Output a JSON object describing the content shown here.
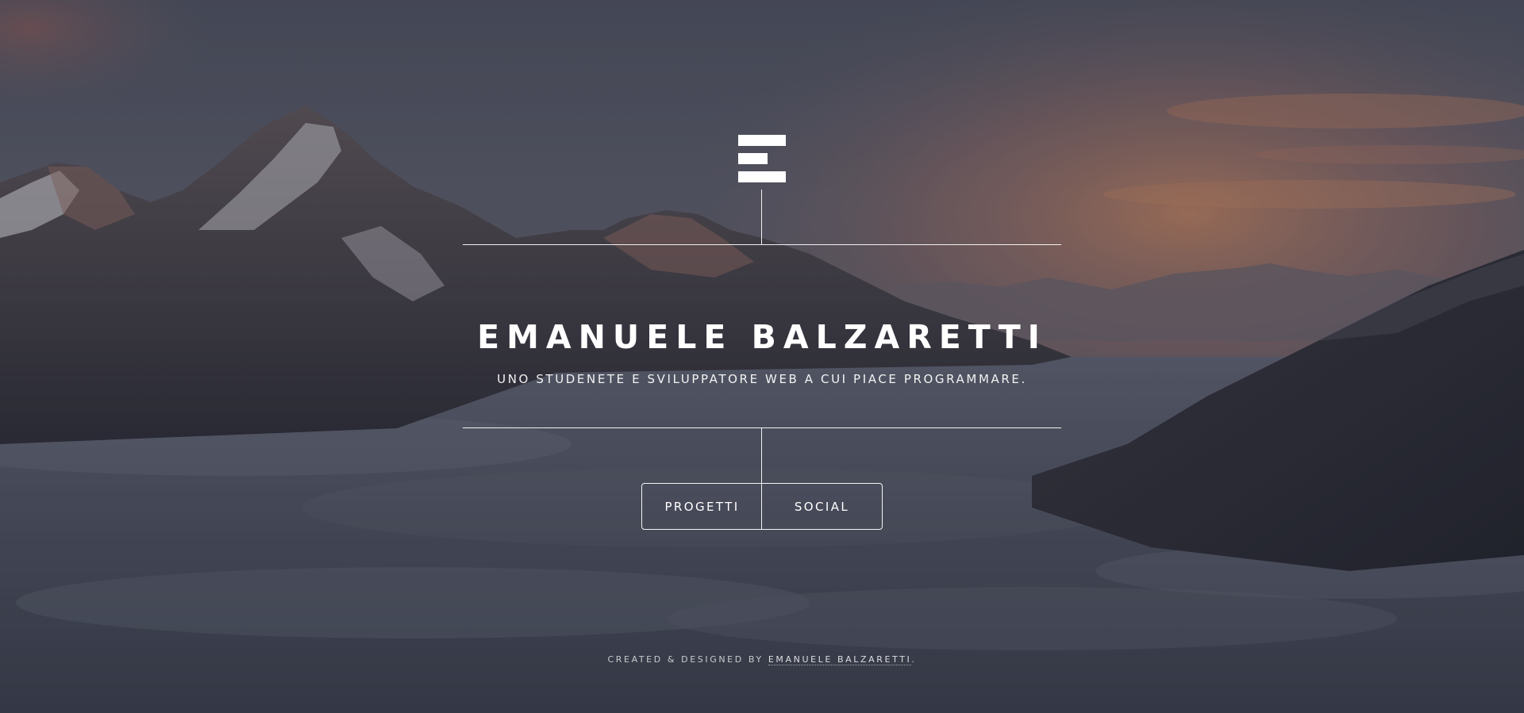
{
  "header": {
    "logo_icon": "e-bars-logo-icon"
  },
  "hero": {
    "title": "EMANUELE BALZARETTI",
    "subtitle": "UNO STUDENETE E SVILUPPATORE WEB A CUI PIACE PROGRAMMARE."
  },
  "nav": {
    "items": [
      {
        "label": "PROGETTI"
      },
      {
        "label": "SOCIAL"
      }
    ]
  },
  "footer": {
    "prefix": "CREATED & DESIGNED BY ",
    "link_label": "EMANUELE BALZARETTI",
    "suffix": "."
  },
  "colors": {
    "text": "#ffffff",
    "sky_dark": "#4b4e5e",
    "sunset": "#b87a5e",
    "clouds": "#5a5d6c"
  }
}
